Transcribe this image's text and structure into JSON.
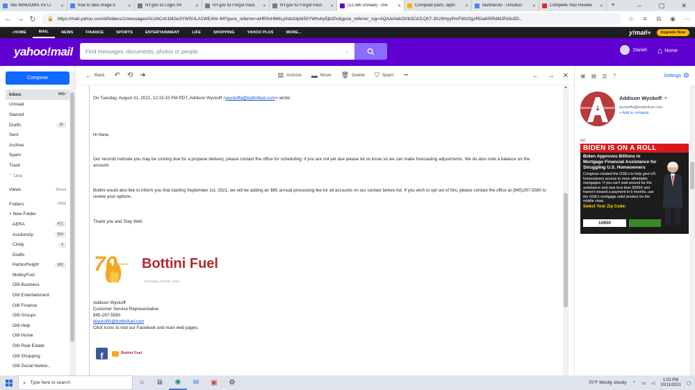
{
  "browser": {
    "tabs": [
      {
        "title": "obs WINDOWS VS LI",
        "color": "#4a86e8",
        "active": false
      },
      {
        "title": "how to take image o",
        "color": "#4a86e8",
        "active": false
      },
      {
        "title": "NY.gov ID Login V4",
        "color": "#7a7a7a",
        "active": false
      },
      {
        "title": "NY.gov ID Forgot Pass",
        "color": "#7a7a7a",
        "active": false
      },
      {
        "title": "NY.gov ID Forgot Pass",
        "color": "#7a7a7a",
        "active": false
      },
      {
        "title": "(12,580 unread) - che",
        "color": "#6001d2",
        "active": true
      },
      {
        "title": "Computer parts, lapto",
        "color": "#f4b400",
        "active": false
      },
      {
        "title": "taulman3D : Unsubsc",
        "color": "#4a86e8",
        "active": false
      },
      {
        "title": "Complete Your Review",
        "color": "#d93025",
        "active": false
      }
    ],
    "url": "https://mail.yahoo.com/d/folders/1/messages/ALVACch1M2w3YWSULA1WEANr-84?guce_referrer=aHR0cHM6Ly9sb2dpbi55YWhvby5jb20v&guce_referrer_sig=AQAAAIekOVb3CdJLQh7-3Xz9HyyPmFWzOgzRDaihRRdMJFd3c5D..."
  },
  "yahoo_nav": {
    "items": [
      "HOME",
      "MAIL",
      "NEWS",
      "FINANCE",
      "SPORTS",
      "ENTERTAINMENT",
      "LIFE",
      "SHOPPING",
      "YAHOO PLUS",
      "MORE..."
    ],
    "brand": "y!mail+",
    "upgrade": "Upgrade Now"
  },
  "header": {
    "logo": "yahoo!mail",
    "search_placeholder": "Find messages, documents, photos or people",
    "user": "Daniel",
    "home": "Home"
  },
  "sidebar": {
    "compose": "Compose",
    "folders": [
      {
        "label": "Inbox",
        "count": "999+",
        "selected": true
      },
      {
        "label": "Unread",
        "count": ""
      },
      {
        "label": "Starred",
        "count": ""
      },
      {
        "label": "Drafts",
        "count": "36"
      },
      {
        "label": "Sent",
        "count": ""
      },
      {
        "label": "Archive",
        "count": ""
      },
      {
        "label": "Spam",
        "count": ""
      },
      {
        "label": "Trash",
        "count": ""
      }
    ],
    "less": "⌃ Less",
    "views": {
      "label": "Views",
      "action": "Show"
    },
    "folders_header": {
      "label": "Folders",
      "action": "Hide"
    },
    "new_folder": "+ New Folder",
    "user_folders": [
      {
        "label": "AERA",
        "count": "471"
      },
      {
        "label": "Auctionzip",
        "count": "364"
      },
      {
        "label": "Cindy",
        "count": "4"
      },
      {
        "label": "Drafts",
        "count": ""
      },
      {
        "label": "Harborfreight",
        "count": "450"
      },
      {
        "label": "MotleyFool",
        "count": ""
      },
      {
        "label": "OI8 Business",
        "count": ""
      },
      {
        "label": "OI8 Entertainment",
        "count": ""
      },
      {
        "label": "OI8 Finance",
        "count": ""
      },
      {
        "label": "OI8 Groups",
        "count": ""
      },
      {
        "label": "OI8 Help",
        "count": ""
      },
      {
        "label": "OI8 Home",
        "count": ""
      },
      {
        "label": "OI8 Real Estate",
        "count": ""
      },
      {
        "label": "OI8 Shopping",
        "count": ""
      },
      {
        "label": "OI8 Social Netwo...",
        "count": ""
      }
    ]
  },
  "toolbar": {
    "back": "Back",
    "archive": "Archive",
    "move": "Move",
    "delete": "Delete",
    "spam": "Spam",
    "more": "•••"
  },
  "message": {
    "quote_header_pre": "On Tuesday, August 31, 2021, 12:15:15 PM PDT, Addison Wyckoff <",
    "quote_email": "wyckoffa@bottinifuel.com",
    "quote_header_post": "> wrote:",
    "greeting": "Hi there,",
    "para1": "Our records indicate you may be coming due for a propane delivery, please contact the office for scheduling. if you are not yet due please let us know so we can make forecasting adjustments. We do also note a balance on the account.",
    "para2": "Bottini would also like to inform you that starting September 1st, 2021, we will be adding an $85 annual processing fee for all accounts on our contact before list. If you wish to opt out of this, please contact the office at (845)297-5580 to review your options.",
    "closing": "Thank you and Stay Well.",
    "logo_years": "70",
    "logo_years_word": "YEARS",
    "logo_name": "Bottini Fuel",
    "logo_established": "ESTABLISHED 1951",
    "sig_name": "Addison Wyckoff",
    "sig_title": "Customer Service Representative",
    "sig_phone": "845-297-5580",
    "sig_email": "WyckoffA@bottinifuel.com",
    "sig_note": "Click Icons to visit our Facebook and main web pages.",
    "mini_logo": "Bottini Fuel"
  },
  "right_pane": {
    "settings": "Settings",
    "contact_name": "Addison Wyckoff",
    "contact_email": "wyckoffa@bottinifuel.com",
    "add_contacts": "+ Add to contacts",
    "ad_label": "AD",
    "ad": {
      "headline": "BIDEN IS ON A ROLL",
      "sub": "Biden Approves Billions in Mortgage Financial Assistance for Struggling U.S. Homeowners",
      "body": "Congress created the GSE's to help give US homeowners access to more affordable mortgages. If you can't wait around for the assistance and owe less than $356K and haven't missed a payment in 6 months, use the GSE's mortgage relief product for the middle class.",
      "cta": "Select Your Zip Code:",
      "zip": "10950"
    }
  },
  "taskbar": {
    "search": "Type here to search",
    "weather": "70°F  Mostly cloudy",
    "time": "1:02 PM",
    "date": "10/11/2021"
  }
}
